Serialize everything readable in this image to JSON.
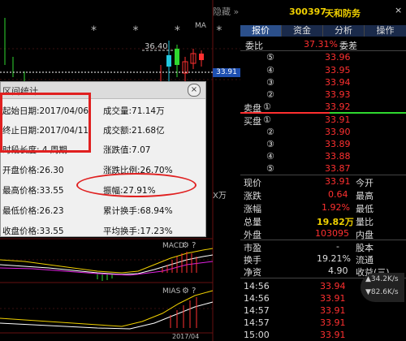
{
  "chart": {
    "hide_label": "隐藏",
    "ma_label": "MA",
    "level_label": "36.40",
    "current_price": "33.91",
    "side_label": "X万",
    "macd_label": "MACD",
    "trix_label": "MIAS",
    "bottom_label": "2017/04"
  },
  "dialog": {
    "title": "区间统计",
    "start_date_label": "起始日期:",
    "start_date": "2017/04/06",
    "end_date_label": "终止日期:",
    "end_date": "2017/04/11",
    "duration_label": "时段长度:",
    "duration": "4 周期",
    "open_label": "开盘价格:",
    "open": "26.30",
    "high_label": "最高价格:",
    "high": "33.55",
    "low_label": "最低价格:",
    "low": "26.23",
    "close_label": "收盘价格:",
    "close": "33.55",
    "volume_label": "成交量:",
    "volume": "71.14万",
    "amount_label": "成交额:",
    "amount": "21.68亿",
    "change_label": "涨跌值:",
    "change": "7.07",
    "change_pct_label": "涨跌比例:",
    "change_pct": "26.70%",
    "amplitude_label": "振幅:",
    "amplitude": "27.91%",
    "turnover_sum_label": "累计换手:",
    "turnover_sum": "68.94%",
    "turnover_avg_label": "平均换手:",
    "turnover_avg": "17.23%"
  },
  "quote": {
    "code": "300397",
    "name": "天和防务",
    "tabs": [
      "报价",
      "资金",
      "分析",
      "操作"
    ],
    "weibi_label": "委比",
    "weibi": "37.31%",
    "weicha_label": "委差",
    "sell_label": "卖盘",
    "buy_label": "买盘",
    "sell": [
      {
        "idx": "⑤",
        "price": "33.96"
      },
      {
        "idx": "④",
        "price": "33.95"
      },
      {
        "idx": "③",
        "price": "33.94"
      },
      {
        "idx": "②",
        "price": "33.93"
      },
      {
        "idx": "①",
        "price": "33.92"
      }
    ],
    "buy": [
      {
        "idx": "①",
        "price": "33.91"
      },
      {
        "idx": "②",
        "price": "33.90"
      },
      {
        "idx": "③",
        "price": "33.89"
      },
      {
        "idx": "④",
        "price": "33.88"
      },
      {
        "idx": "⑤",
        "price": "33.87"
      }
    ],
    "stats": {
      "xianjia_label": "现价",
      "xianjia": "33.91",
      "jinkai_label": "今开",
      "zhangdie_label": "涨跌",
      "zhangdie": "0.64",
      "zuigao_label": "最高",
      "zhangfu_label": "涨幅",
      "zhangfu": "1.92%",
      "zuidi_label": "最低",
      "zongliang_label": "总量",
      "zongliang": "19.82万",
      "liangbi_label": "量比",
      "waipan_label": "外盘",
      "waipan": "103095",
      "neipan_label": "内盘",
      "shiying_label": "市盈",
      "shiying": "-",
      "guben_label": "股本",
      "huanshou_label": "换手",
      "huanshou": "19.21%",
      "liutong_label": "流通",
      "jingzi_label": "净资",
      "jingzi": "4.90",
      "shouyi_label": "收益(三)"
    },
    "ticks": [
      {
        "time": "14:56",
        "price": "33.94"
      },
      {
        "time": "14:56",
        "price": "33.91"
      },
      {
        "time": "14:57",
        "price": "33.91"
      },
      {
        "time": "14:57",
        "price": "33.91"
      },
      {
        "time": "15:00",
        "price": "33.91"
      }
    ],
    "net_up": "34.2K/s",
    "net_down": "82.6K/s"
  }
}
